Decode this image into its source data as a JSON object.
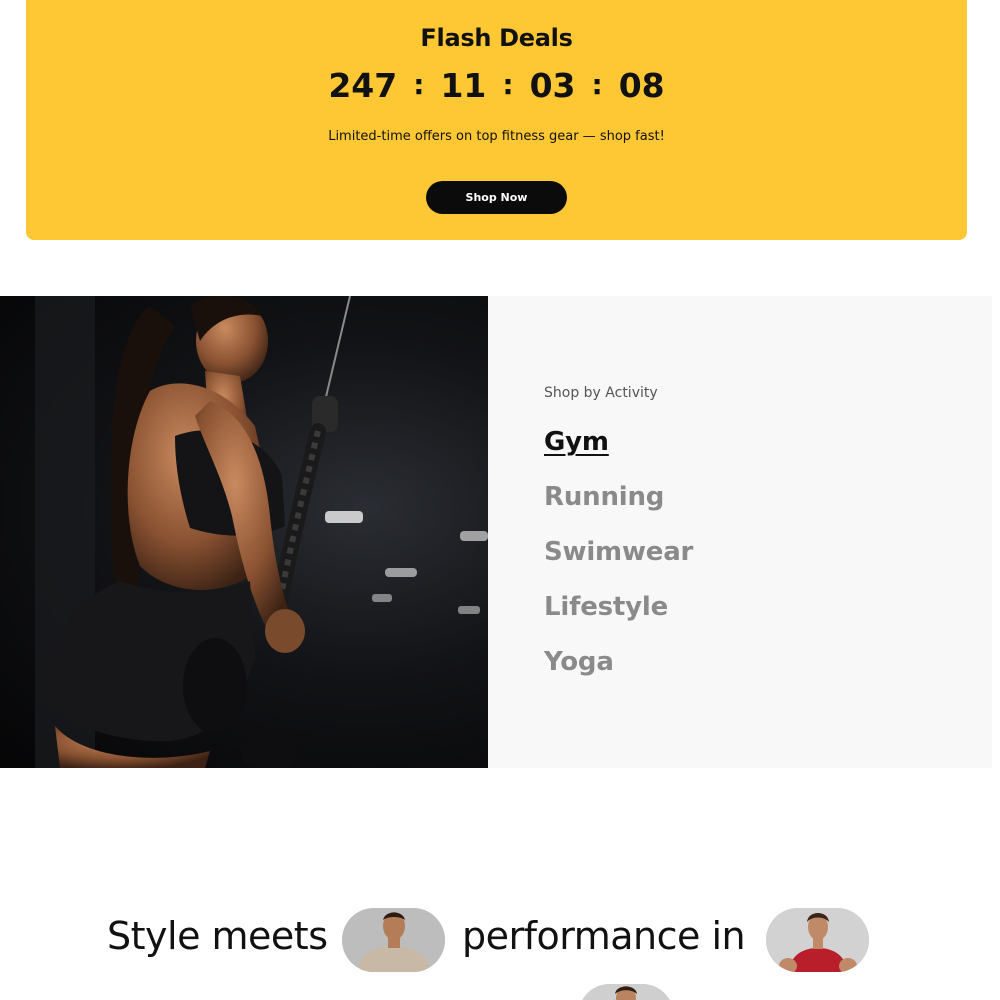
{
  "flash_deals": {
    "title": "Flash Deals",
    "countdown": {
      "days": "247",
      "hours": "11",
      "minutes": "03",
      "seconds": "08",
      "separator": ":"
    },
    "subtitle": "Limited-time offers on top fitness gear — shop fast!",
    "button_label": "Shop Now"
  },
  "activity": {
    "eyebrow": "Shop by Activity",
    "items": [
      {
        "label": "Gym",
        "active": true
      },
      {
        "label": "Running",
        "active": false
      },
      {
        "label": "Swimwear",
        "active": false
      },
      {
        "label": "Lifestyle",
        "active": false
      },
      {
        "label": "Yoga",
        "active": false
      }
    ]
  },
  "headline": {
    "part1": "Style meets",
    "part2": "performance in"
  },
  "colors": {
    "banner": "#fec734",
    "button": "#0b0b0b",
    "active_text": "#111111",
    "inactive_text": "#8a8a8a"
  }
}
